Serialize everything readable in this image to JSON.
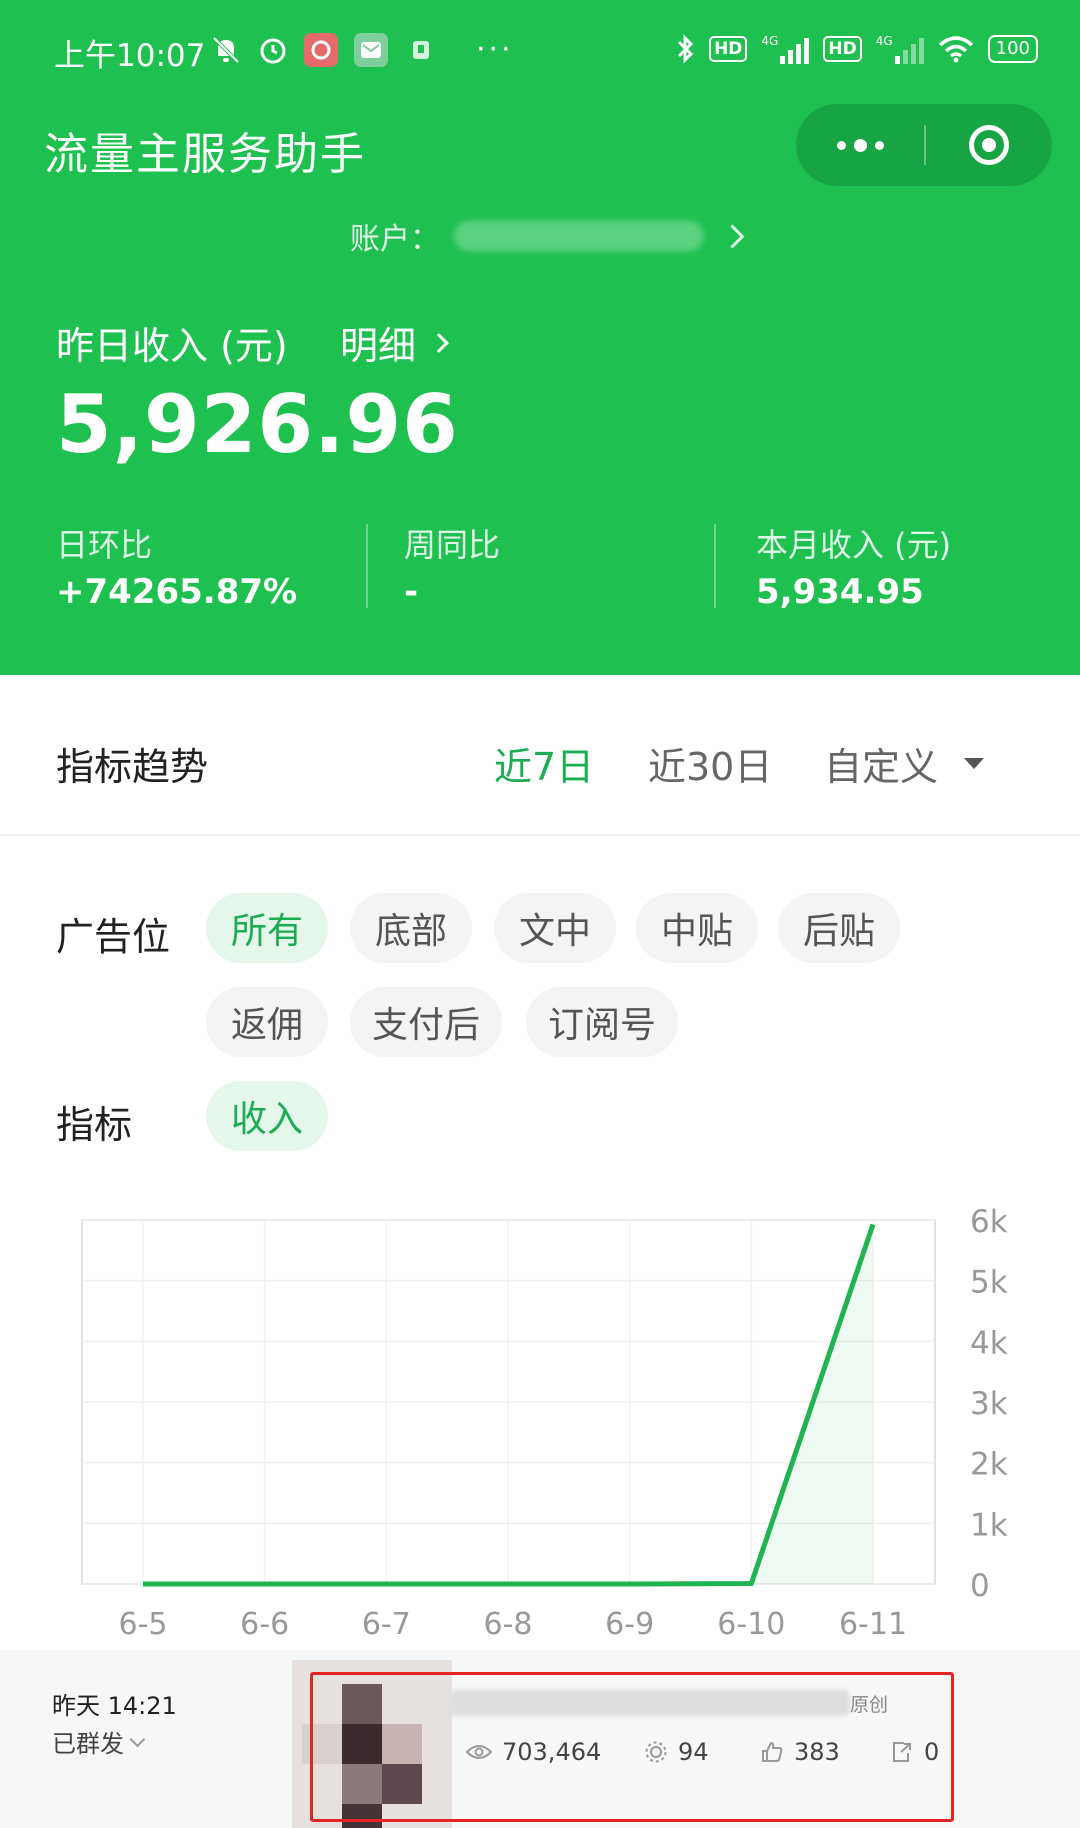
{
  "status_bar": {
    "time": "上午10:07",
    "network_label": "4G",
    "hd_label": "HD",
    "battery": "100"
  },
  "app": {
    "title": "流量主服务助手"
  },
  "account": {
    "label": "账户："
  },
  "summary": {
    "yesterday_label": "昨日收入 (元)",
    "detail_link": "明细",
    "yesterday_value": "5,926.96",
    "day_ratio_label": "日环比",
    "day_ratio_value": "+74265.87%",
    "week_ratio_label": "周同比",
    "week_ratio_value": "-",
    "month_income_label": "本月收入 (元)",
    "month_income_value": "5,934.95"
  },
  "trend": {
    "title": "指标趋势",
    "ranges": [
      "近7日",
      "近30日",
      "自定义"
    ],
    "active_range": "近7日"
  },
  "filters": {
    "ad_slot_label": "广告位",
    "ad_slots": [
      "所有",
      "底部",
      "文中",
      "中贴",
      "后贴",
      "返佣",
      "支付后",
      "订阅号"
    ],
    "active_ad_slot": "所有",
    "metric_label": "指标",
    "metrics": [
      "收入"
    ],
    "active_metric": "收入"
  },
  "chart_data": {
    "type": "line",
    "x": [
      "6-5",
      "6-6",
      "6-7",
      "6-8",
      "6-9",
      "6-10",
      "6-11"
    ],
    "series": [
      {
        "values": [
          0,
          0,
          0,
          0,
          0,
          8,
          5927
        ]
      }
    ],
    "y_ticks": [
      "0",
      "1k",
      "2k",
      "3k",
      "4k",
      "5k",
      "6k"
    ],
    "ylim": [
      0,
      6000
    ],
    "y_axis_side": "right",
    "grid": true,
    "line_color": "#1fb451"
  },
  "article": {
    "time": "昨天 14:21",
    "status": "已群发",
    "tag": "原创",
    "reads": "703,464",
    "shares": "94",
    "likes": "383",
    "forwards": "0"
  },
  "colors": {
    "brand_green": "#1ec04f",
    "active_text": "#1aad52",
    "highlight_red": "#e62424"
  }
}
